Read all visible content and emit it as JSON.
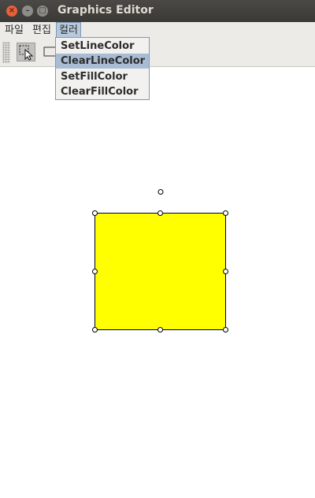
{
  "window": {
    "title": "Graphics Editor"
  },
  "menubar": {
    "items": [
      "파일",
      "편집",
      "컬러"
    ]
  },
  "color_menu": {
    "items": [
      "SetLineColor",
      "ClearLineColor",
      "SetFillColor",
      "ClearFillColor"
    ],
    "highlighted": "ClearLineColor"
  },
  "toolbar": {
    "tools": [
      "select-tool",
      "rectangle-tool"
    ]
  },
  "shape": {
    "type": "rectangle",
    "fill_color": "#ffff00",
    "line_color": "#000000",
    "selected": true
  }
}
